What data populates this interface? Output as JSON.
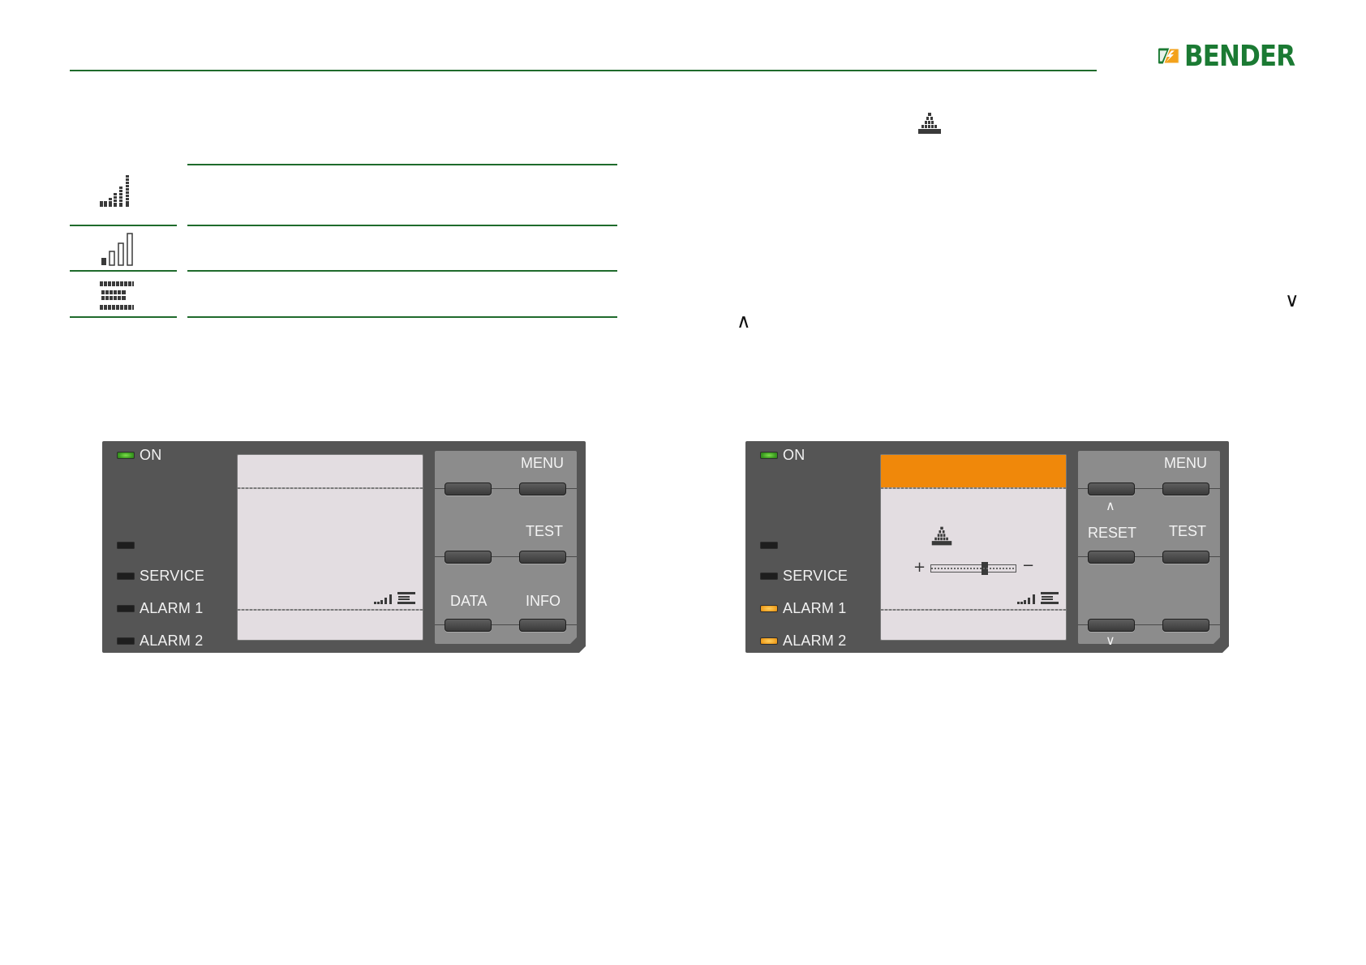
{
  "header": {
    "brand": "BENDER"
  },
  "colors": {
    "accent": "#1f6b2c",
    "brand_green": "#1b7a33",
    "brand_orange": "#f0a020",
    "alarm": "#f0a020",
    "led_on": "#5cc030",
    "lcd_alert": "#f0880a"
  },
  "symbols": [
    {
      "icon": "dotted-bar-graph-icon"
    },
    {
      "icon": "outline-bar-graph-icon"
    },
    {
      "icon": "dotted-grid-icon"
    }
  ],
  "text": {
    "arrow_down": "∨",
    "arrow_up": "∧"
  },
  "left_device": {
    "leds": [
      {
        "label": "ON",
        "state": "green"
      },
      {
        "label": "",
        "state": "off"
      },
      {
        "label": "SERVICE",
        "state": "off"
      },
      {
        "label": "ALARM 1",
        "state": "off"
      },
      {
        "label": "ALARM 2",
        "state": "off"
      }
    ],
    "keys": {
      "menu": "MENU",
      "test": "TEST",
      "data": "DATA",
      "info": "INFO"
    }
  },
  "right_device": {
    "leds": [
      {
        "label": "ON",
        "state": "green"
      },
      {
        "label": "",
        "state": "off"
      },
      {
        "label": "SERVICE",
        "state": "off"
      },
      {
        "label": "ALARM 1",
        "state": "amber"
      },
      {
        "label": "ALARM 2",
        "state": "amber"
      }
    ],
    "keys": {
      "menu": "MENU",
      "test": "TEST",
      "reset": "RESET",
      "up": "∧",
      "down": "∨"
    },
    "lcd": {
      "plus": "+",
      "minus": "−"
    }
  }
}
